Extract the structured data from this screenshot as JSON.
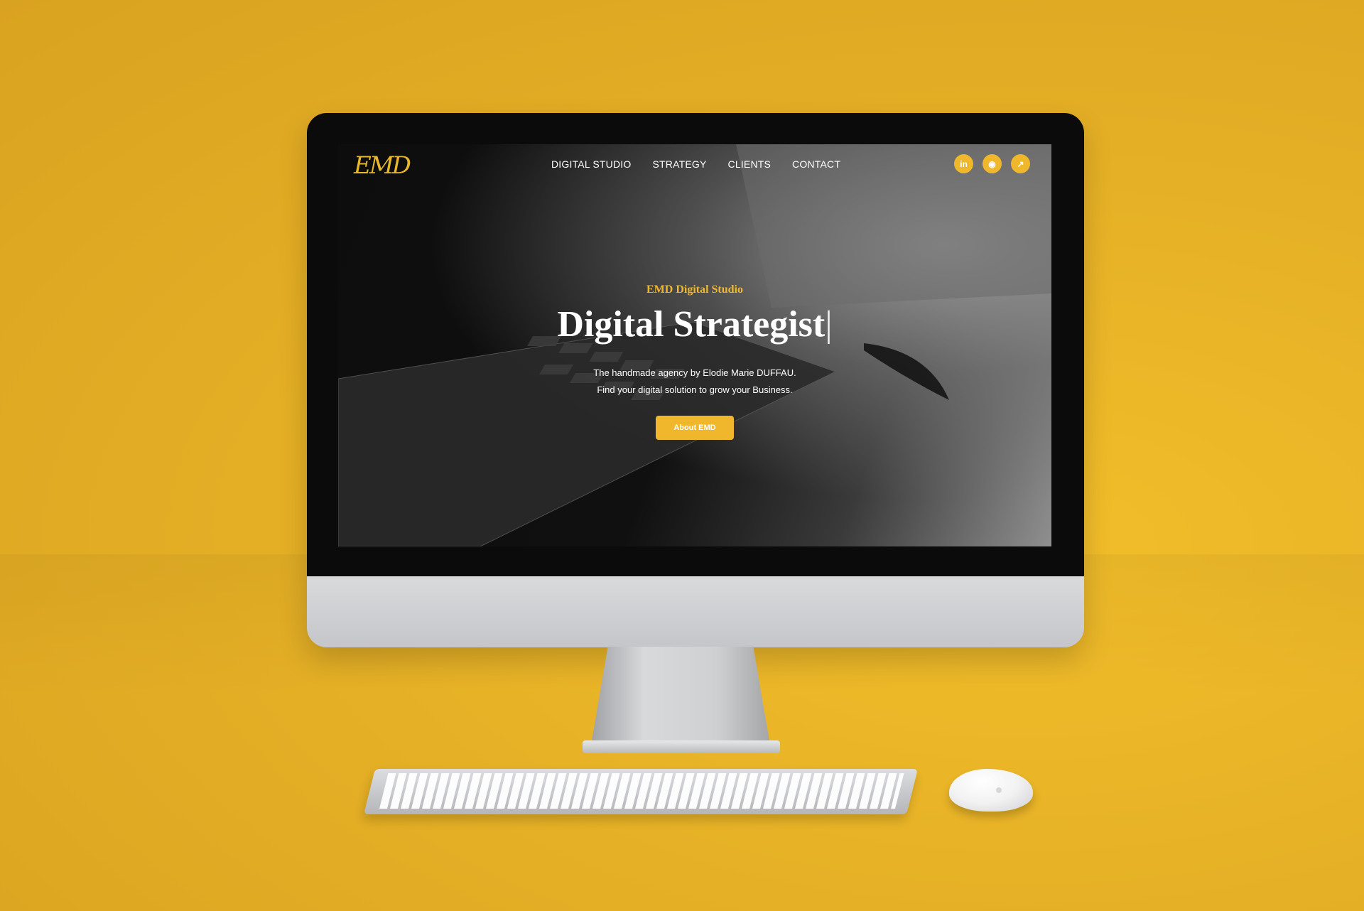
{
  "site": {
    "logo_text": "EMD",
    "nav": [
      {
        "label": "DIGITAL STUDIO"
      },
      {
        "label": "STRATEGY"
      },
      {
        "label": "CLIENTS"
      },
      {
        "label": "CONTACT"
      }
    ],
    "social": [
      {
        "icon": "linkedin-icon",
        "glyph": "in"
      },
      {
        "icon": "github-icon",
        "glyph": "◉"
      },
      {
        "icon": "external-link-icon",
        "glyph": "↗"
      }
    ],
    "hero": {
      "eyebrow": "EMD Digital Studio",
      "headline": "Digital Strategist",
      "cursor": "|",
      "subtitle_line1": "The handmade agency by Elodie Marie DUFFAU.",
      "subtitle_line2": "Find your digital solution to grow your Business.",
      "cta_label": "About EMD"
    }
  },
  "colors": {
    "accent": "#f0b72c",
    "background": "#e3b024",
    "screen": "#121212"
  }
}
